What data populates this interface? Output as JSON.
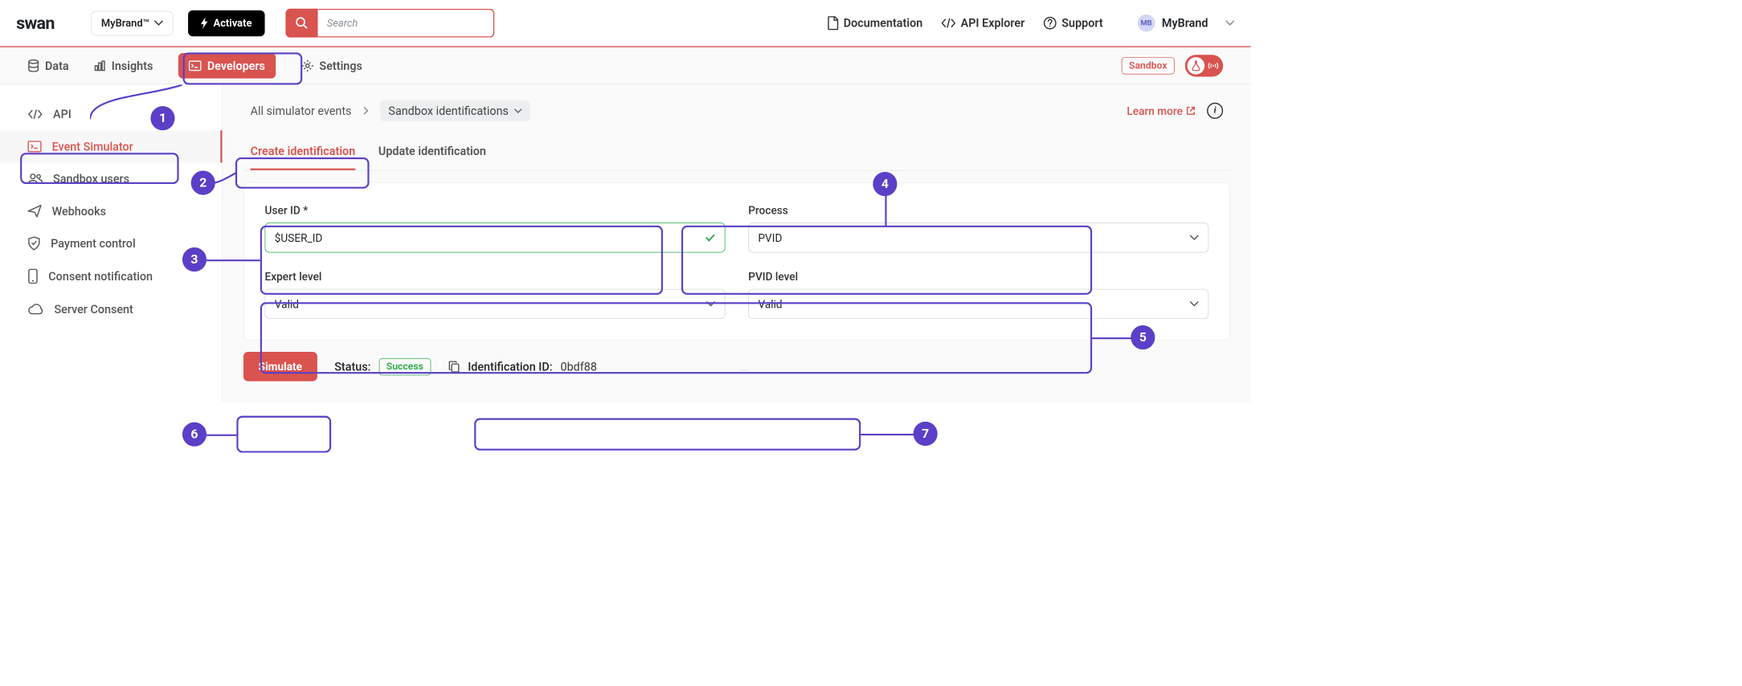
{
  "header": {
    "logo": "swan",
    "brand_dropdown": "MyBrand™",
    "activate": "Activate",
    "search_placeholder": "Search",
    "links": {
      "docs": "Documentation",
      "api": "API Explorer",
      "support": "Support"
    },
    "brand_indicator": {
      "initials": "MB",
      "name": "MyBrand"
    }
  },
  "nav": {
    "data": "Data",
    "insights": "Insights",
    "developers": "Developers",
    "settings": "Settings",
    "env_label": "Sandbox"
  },
  "sidebar": {
    "api": "API",
    "event_simulator": "Event Simulator",
    "sandbox_users": "Sandbox users",
    "webhooks": "Webhooks",
    "payment_control": "Payment control",
    "consent_notification": "Consent notification",
    "server_consent": "Server Consent"
  },
  "breadcrumb": {
    "all_events": "All simulator events",
    "current": "Sandbox identifications",
    "learn_more": "Learn more"
  },
  "tabs": {
    "create": "Create identification",
    "update": "Update identification"
  },
  "form": {
    "user_id_label": "User ID *",
    "user_id_value": "$USER_ID",
    "process_label": "Process",
    "process_value": "PVID",
    "expert_label": "Expert level",
    "expert_value": "Valid",
    "pvid_label": "PVID level",
    "pvid_value": "Valid"
  },
  "result": {
    "simulate": "Simulate",
    "status_label": "Status:",
    "status_value": "Success",
    "id_label": "Identification ID:",
    "id_value": "0bdf88"
  },
  "annotations": [
    "1",
    "2",
    "3",
    "4",
    "5",
    "6",
    "7"
  ]
}
